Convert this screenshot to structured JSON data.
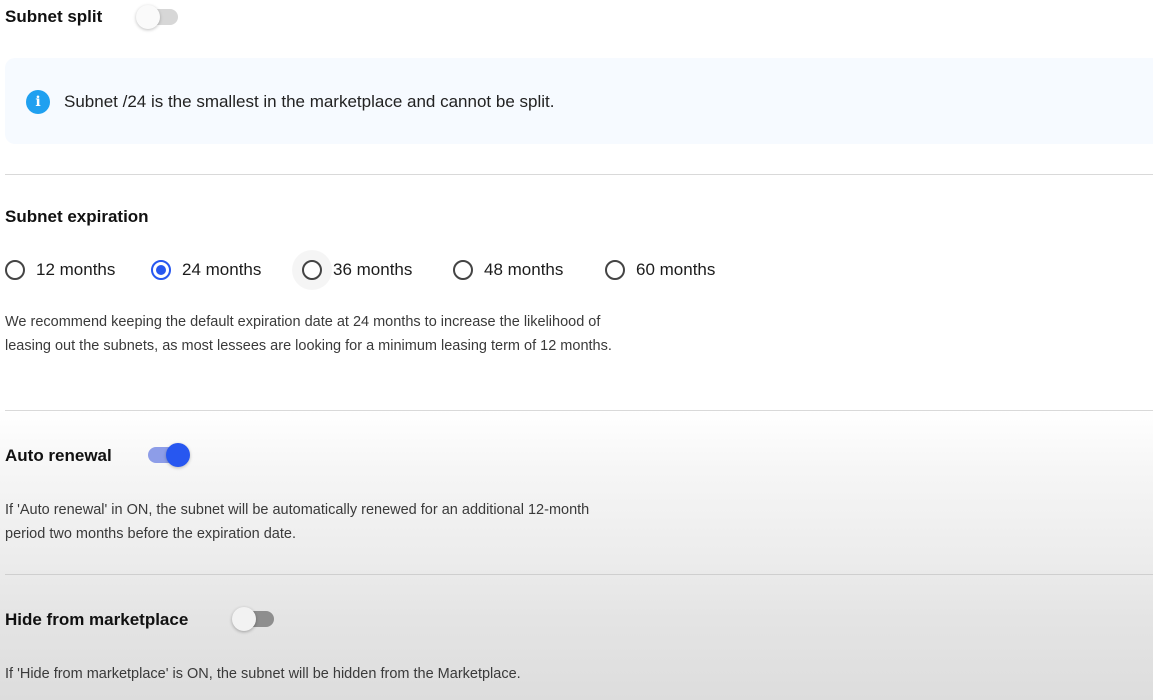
{
  "subnet_split": {
    "heading": "Subnet split",
    "toggle_on": false,
    "info_icon": "info-icon",
    "info_glyph": "i",
    "info_text": "Subnet /24 is the smallest in the marketplace and cannot be split."
  },
  "subnet_expiration": {
    "heading": "Subnet expiration",
    "options": [
      {
        "label": "12 months",
        "checked": false
      },
      {
        "label": "24 months",
        "checked": true
      },
      {
        "label": "36 months",
        "checked": false
      },
      {
        "label": "48 months",
        "checked": false
      },
      {
        "label": "60 months",
        "checked": false
      }
    ],
    "description": "We recommend keeping the default expiration date at 24 months to increase the likelihood of leasing out the subnets, as most lessees are looking for a minimum leasing term of 12 months."
  },
  "auto_renewal": {
    "heading": "Auto renewal",
    "toggle_on": true,
    "description": "If 'Auto renewal' in ON, the subnet will be automatically renewed for an additional 12-month period two months before the expiration date."
  },
  "hide_from_marketplace": {
    "heading": "Hide from marketplace",
    "toggle_on": false,
    "description": "If 'Hide from marketplace' is ON, the subnet will be hidden from the Marketplace."
  },
  "colors": {
    "accent": "#2757f0",
    "accent_track": "#8d9de8",
    "info_icon": "#1fa0f0",
    "info_background": "#f6faff"
  }
}
